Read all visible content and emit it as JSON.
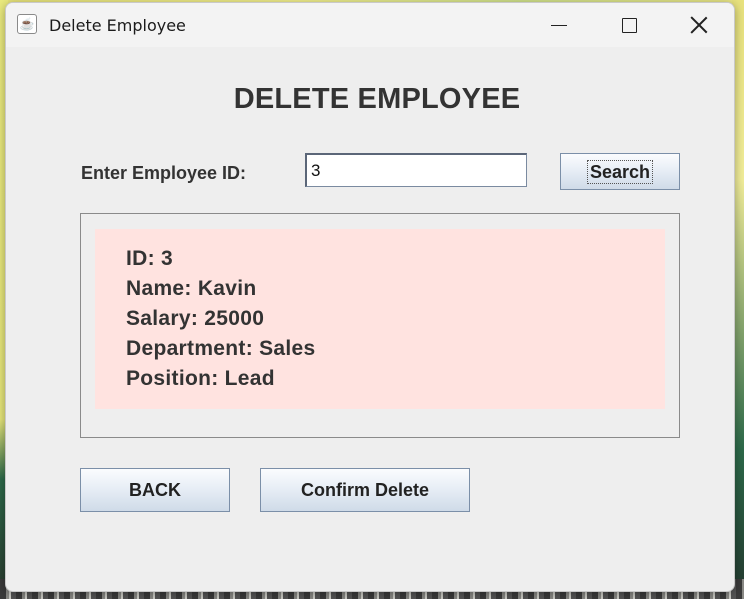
{
  "window": {
    "title": "Delete Employee",
    "app_icon": "java-cup-icon"
  },
  "form": {
    "heading": "DELETE EMPLOYEE",
    "id_label": "Enter Employee ID:",
    "id_value": "3",
    "search_label": "Search"
  },
  "employee": {
    "id_line": "ID: 3",
    "name_line": "Name: Kavin",
    "salary_line": "Salary: 25000",
    "department_line": "Department: Sales",
    "position_line": "Position: Lead"
  },
  "actions": {
    "back_label": "BACK",
    "confirm_label": "Confirm Delete"
  },
  "colors": {
    "panel_bg": "#ffe3e0",
    "window_bg": "#eeeeee",
    "text": "#333333"
  }
}
